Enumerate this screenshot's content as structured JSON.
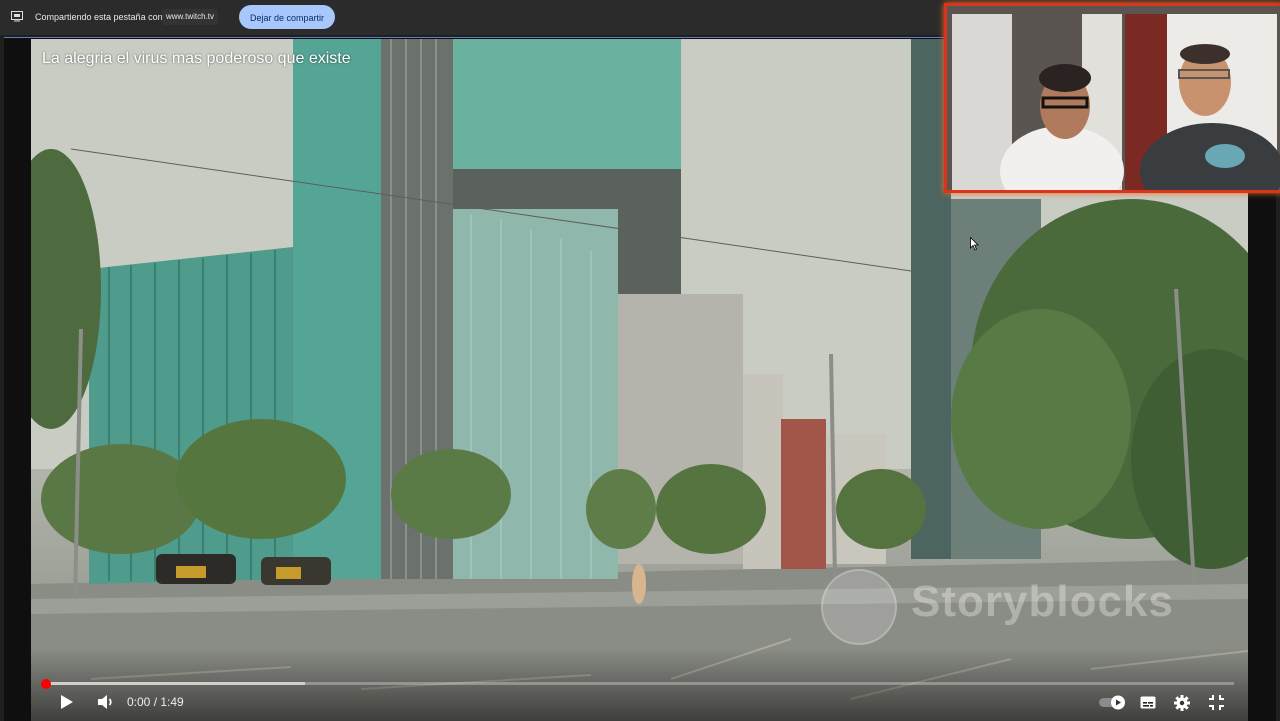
{
  "share_bar": {
    "message": "Compartiendo esta pestaña con",
    "site": "www.twitch.tv",
    "stop_button": "Dejar de compartir"
  },
  "video": {
    "title": "La alegria el virus mas poderoso que existe",
    "watermark": "Storyblocks"
  },
  "controls": {
    "time": "0:00 / 1:49",
    "progress_played": 0.0,
    "progress_buffered": 0.22
  },
  "icons": {
    "share": "screen-share-icon",
    "play": "play-icon",
    "volume": "volume-icon",
    "autoplay": "autoplay-toggle-icon",
    "subtitles": "subtitles-icon",
    "settings": "gear-icon",
    "exit_fullscreen": "exit-fullscreen-icon"
  },
  "colors": {
    "stop_button_bg": "#a8c7fa",
    "progress_red": "#ff0000",
    "webcam_border": "#d9341c"
  }
}
